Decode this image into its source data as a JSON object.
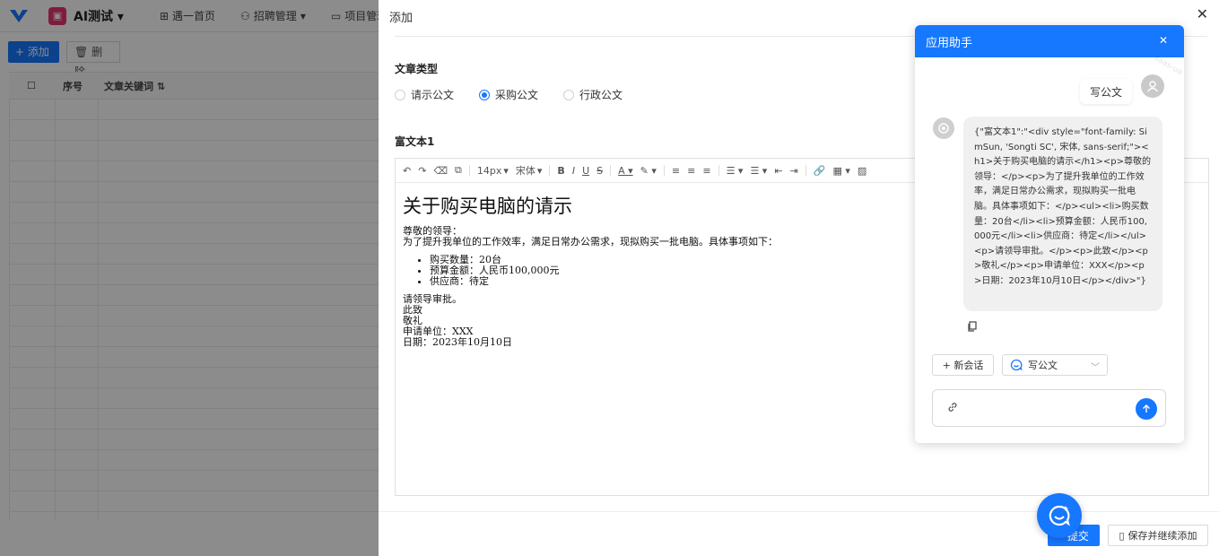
{
  "app": {
    "name": "AI测试",
    "nav": [
      "遇一首页",
      "招聘管理",
      "项目管理"
    ],
    "toolbar": {
      "add_label": "添加",
      "delete_label": "删除"
    },
    "table_headers": {
      "index": "序号",
      "keyword": "文章关键词"
    }
  },
  "drawer": {
    "title": "添加",
    "article_type_label": "文章类型",
    "article_types": [
      {
        "label": "请示公文",
        "checked": false
      },
      {
        "label": "采购公文",
        "checked": true
      },
      {
        "label": "行政公文",
        "checked": false
      }
    ],
    "richtext_label": "富文本1",
    "toolbar": {
      "font_size": "14px",
      "font_family": "宋体"
    },
    "content": {
      "heading": "关于购买电脑的请示",
      "greeting": "尊敬的领导：",
      "intro": "为了提升我单位的工作效率，满足日常办公需求，现拟购买一批电脑。具体事项如下：",
      "items": [
        "购买数量：20台",
        "预算金额：人民币100,000元",
        "供应商：待定"
      ],
      "closing1": "请领导审批。",
      "closing2": "此致",
      "closing3": "敬礼",
      "unit": "申请单位：XXX",
      "date": "日期：2023年10月10日"
    },
    "submit_label": "提交",
    "save_continue_label": "保存并继续添加"
  },
  "assistant": {
    "title": "应用助手",
    "user_message": "写公文",
    "bot_message": "{\"富文本1\":\"<div style=\"font-family: SimSun, 'Songti SC', 宋体, sans-serif;\"><h1>关于购买电脑的请示</h1><p>尊敬的领导：</p><p>为了提升我单位的工作效率，满足日常办公需求，现拟购买一批电脑。具体事项如下：</p><ul><li>购买数量：20台</li><li>预算金额：人民币100,000元</li><li>供应商：待定</li></ul><p>请领导审批。</p><p>此致</p><p>敬礼</p><p>申请单位：XXX</p><p>日期：2023年10月10日</p></div>\"}",
    "new_chat_label": "+ 新会话",
    "app_select_value": "写公文",
    "input_placeholder": "",
    "watermark": "saas-ua"
  }
}
